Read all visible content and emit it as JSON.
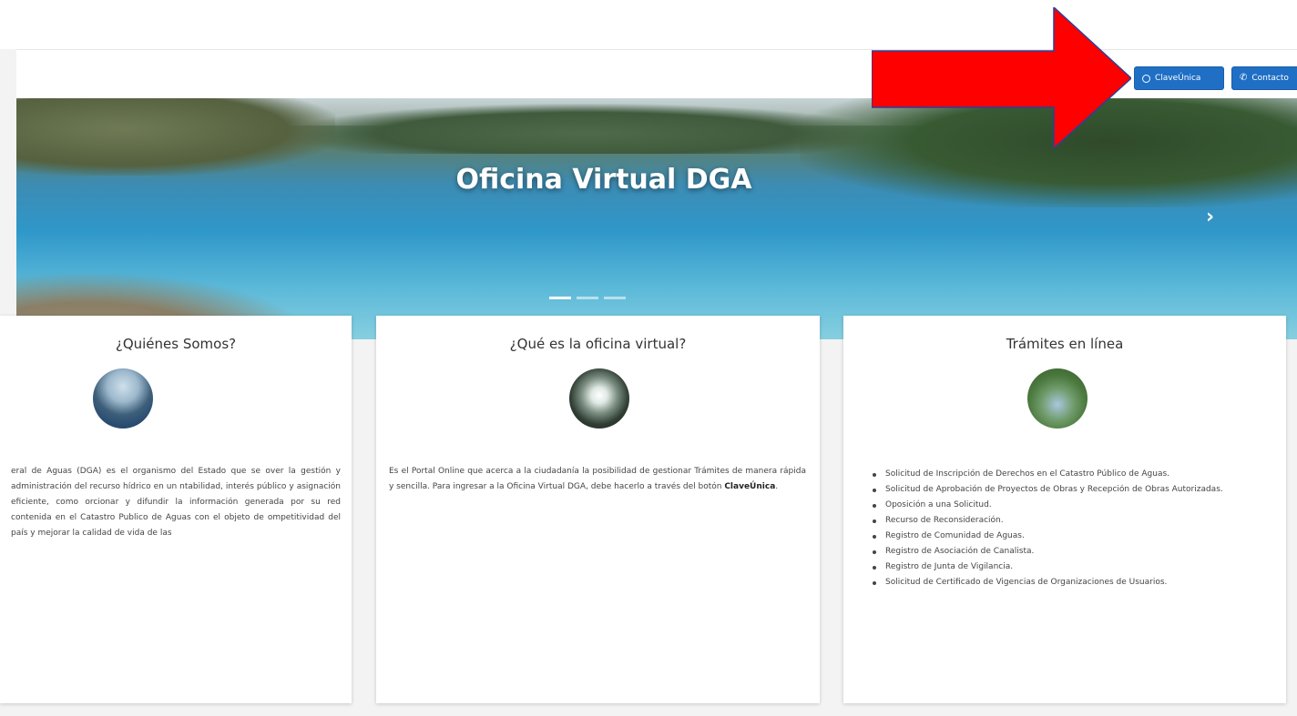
{
  "nav": {
    "clave_label": "ClaveÚnica",
    "contacto_label": "Contacto"
  },
  "hero": {
    "title": "Oficina Virtual DGA",
    "next_icon": "chevron-right-icon",
    "next_glyph": "›",
    "active_slide": 1,
    "slide_count": 3
  },
  "cards": {
    "quienes": {
      "title": "¿Quiénes Somos?",
      "text": "eral de Aguas (DGA) es el organismo del Estado que se over la gestión y administración del recurso hídrico en un ntabilidad, interés público y asignación eficiente, como orcionar y difundir la información generada por su red contenida en el Catastro Publico de Aguas con el objeto de ompetitividad del país y mejorar la calidad de vida de las"
    },
    "oficina": {
      "title": "¿Qué es la oficina virtual?",
      "text_before": "Es el Portal Online que acerca a la ciudadanía la posibilidad de gestionar Trámites de manera rápida y sencilla. Para ingresar a la Oficina Virtual DGA, debe hacerlo a través del botón ",
      "text_bold": "ClaveÚnica",
      "text_after": "."
    },
    "tramites": {
      "title": "Trámites en línea",
      "items": [
        "Solicitud de Inscripción de Derechos en el Catastro Público de Aguas.",
        "Solicitud de Aprobación de Proyectos de Obras y Recepción de Obras Autorizadas.",
        "Oposición a una Solicitud.",
        "Recurso de Reconsideración.",
        "Registro de Comunidad de Aguas.",
        "Registro de Asociación de Canalista.",
        "Registro de Junta de Vigilancia.",
        "Solicitud de Certificado de Vigencias de Organizaciones de Usuarios."
      ]
    }
  },
  "colors": {
    "button_blue": "#1f6fc5",
    "annotation_red": "#ff0000"
  }
}
